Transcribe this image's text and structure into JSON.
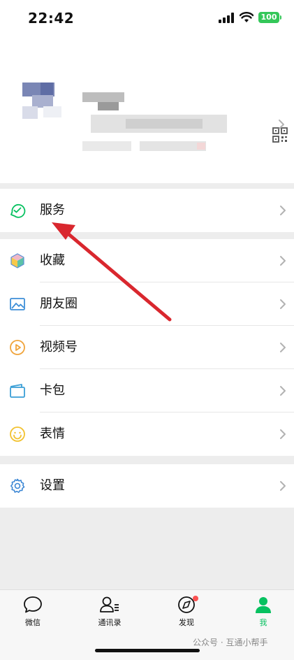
{
  "status_bar": {
    "time": "22:42",
    "battery": "100"
  },
  "menu": {
    "services": "服务",
    "favorites": "收藏",
    "moments": "朋友圈",
    "channels": "视频号",
    "cards": "卡包",
    "stickers": "表情",
    "settings": "设置"
  },
  "tabbar": {
    "chats": "微信",
    "contacts": "通讯录",
    "discover": "发现",
    "me": "我"
  },
  "watermark": "公众号 · 互通小帮手",
  "colors": {
    "accent": "#07c160",
    "arrow": "#d9272e",
    "battery": "#34c759",
    "badge": "#fa5151"
  }
}
